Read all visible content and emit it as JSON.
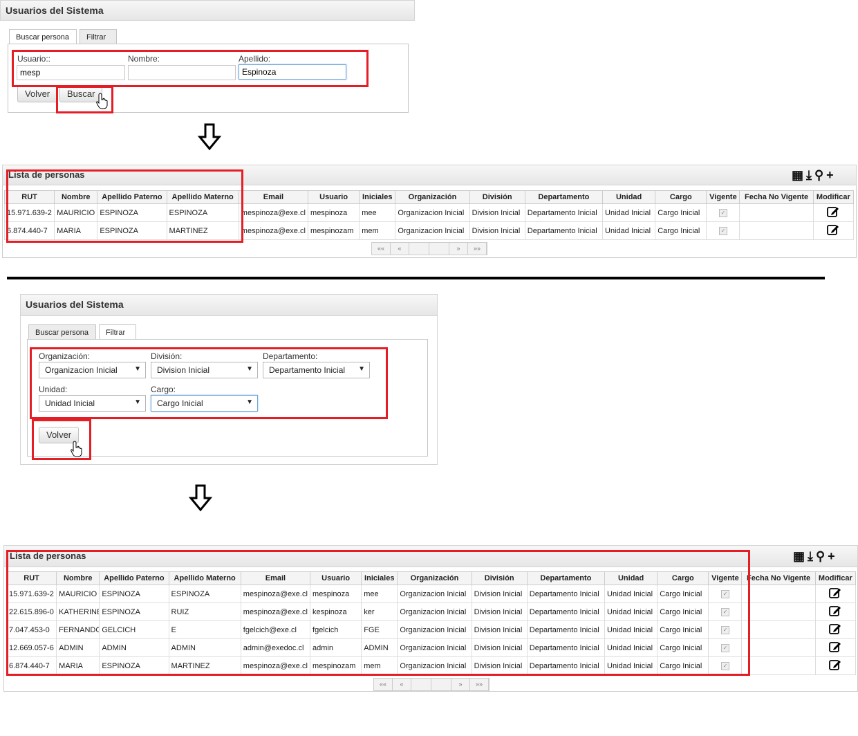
{
  "panel1": {
    "title": "Usuarios del Sistema",
    "tabs": [
      "Buscar persona",
      "Filtrar"
    ],
    "usuario_label": "Usuario::",
    "usuario_value": "mesp",
    "nombre_label": "Nombre:",
    "nombre_value": "",
    "apellido_label": "Apellido:",
    "apellido_value": "Espinoza",
    "volver": "Volver",
    "buscar": "Buscar"
  },
  "list1": {
    "title": "Lista de personas",
    "columns": [
      "RUT",
      "Nombre",
      "Apellido Paterno",
      "Apellido Materno",
      "Email",
      "Usuario",
      "Iniciales",
      "Organización",
      "División",
      "Departamento",
      "Unidad",
      "Cargo",
      "Vigente",
      "Fecha No Vigente",
      "Modificar"
    ],
    "rows": [
      [
        "15.971.639-2",
        "MAURICIO",
        "ESPINOZA",
        "ESPINOZA",
        "mespinoza@exe.cl",
        "mespinoza",
        "mee",
        "Organizacion Inicial",
        "Division Inicial",
        "Departamento Inicial",
        "Unidad Inicial",
        "Cargo Inicial"
      ],
      [
        "6.874.440-7",
        "MARIA",
        "ESPINOZA",
        "MARTINEZ",
        "mespinoza@exe.cl",
        "mespinozam",
        "mem",
        "Organizacion Inicial",
        "Division Inicial",
        "Departamento Inicial",
        "Unidad Inicial",
        "Cargo Inicial"
      ]
    ],
    "pager": [
      "««",
      "«",
      "",
      "",
      "»",
      "»»"
    ]
  },
  "panel2": {
    "title": "Usuarios del Sistema",
    "tabs": [
      "Buscar persona",
      "Filtrar"
    ],
    "org_label": "Organización:",
    "org_value": "Organizacion Inicial",
    "div_label": "División:",
    "div_value": "Division Inicial",
    "dep_label": "Departamento:",
    "dep_value": "Departamento Inicial",
    "uni_label": "Unidad:",
    "uni_value": "Unidad Inicial",
    "cargo_label": "Cargo:",
    "cargo_value": "Cargo Inicial",
    "volver": "Volver"
  },
  "list2": {
    "title": "Lista de personas",
    "columns": [
      "RUT",
      "Nombre",
      "Apellido Paterno",
      "Apellido Materno",
      "Email",
      "Usuario",
      "Iniciales",
      "Organización",
      "División",
      "Departamento",
      "Unidad",
      "Cargo",
      "Vigente",
      "Fecha No Vigente",
      "Modificar"
    ],
    "rows": [
      [
        "15.971.639-2",
        "MAURICIO",
        "ESPINOZA",
        "ESPINOZA",
        "mespinoza@exe.cl",
        "mespinoza",
        "mee",
        "Organizacion Inicial",
        "Division Inicial",
        "Departamento Inicial",
        "Unidad Inicial",
        "Cargo Inicial"
      ],
      [
        "22.615.896-0",
        "KATHERINE",
        "ESPINOZA",
        "RUIZ",
        "mespinoza@exe.cl",
        "kespinoza",
        "ker",
        "Organizacion Inicial",
        "Division Inicial",
        "Departamento Inicial",
        "Unidad Inicial",
        "Cargo Inicial"
      ],
      [
        "7.047.453-0",
        "FERNANDO",
        "GELCICH",
        "E",
        "fgelcich@exe.cl",
        "fgelcich",
        "FGE",
        "Organizacion Inicial",
        "Division Inicial",
        "Departamento Inicial",
        "Unidad Inicial",
        "Cargo Inicial"
      ],
      [
        "12.669.057-6",
        "ADMIN",
        "ADMIN",
        "ADMIN",
        "admin@exedoc.cl",
        "admin",
        "ADMIN",
        "Organizacion Inicial",
        "Division Inicial",
        "Departamento Inicial",
        "Unidad Inicial",
        "Cargo Inicial"
      ],
      [
        "6.874.440-7",
        "MARIA",
        "ESPINOZA",
        "MARTINEZ",
        "mespinoza@exe.cl",
        "mespinozam",
        "mem",
        "Organizacion Inicial",
        "Division Inicial",
        "Departamento Inicial",
        "Unidad Inicial",
        "Cargo Inicial"
      ]
    ],
    "pager": [
      "««",
      "«",
      "",
      "",
      "»",
      "»»"
    ]
  },
  "icons": [
    "columns-icon",
    "download-icon",
    "search-icon",
    "add-icon",
    "edit-icon",
    "checkbox-icon",
    "hand-cursor-icon",
    "arrow-down-icon"
  ],
  "colors": {
    "highlight": "#e51d25",
    "focus": "#6fa6d6"
  }
}
